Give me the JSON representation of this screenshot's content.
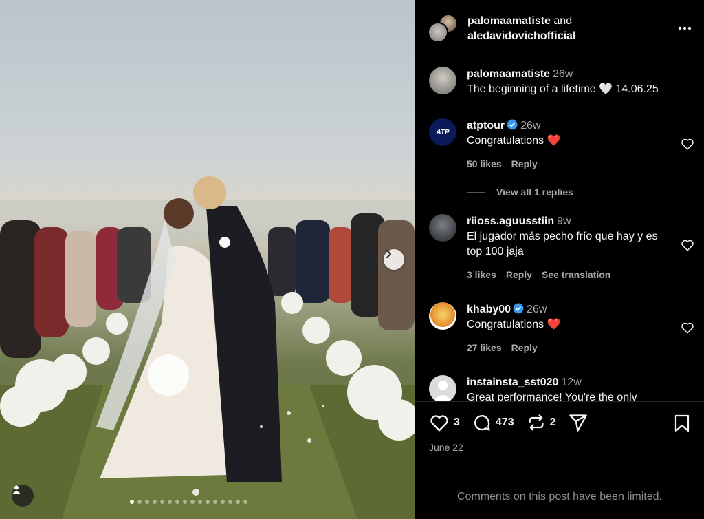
{
  "post": {
    "photo_alt": "Wedding ceremony photo",
    "carousel": {
      "total": 16,
      "active": 0
    }
  },
  "header": {
    "user1": "palomaamatiste",
    "joiner": "and",
    "user2": "aledavidovichofficial"
  },
  "caption": {
    "username": "palomaamatiste",
    "time": "26w",
    "text": "The beginning of a lifetime 🤍 14.06.25"
  },
  "comments": [
    {
      "username": "atptour",
      "verified": true,
      "time": "26w",
      "text": "Congratulations ❤️",
      "likes": "50 likes",
      "reply": "Reply"
    },
    {
      "username": "riioss.aguusstiin",
      "verified": false,
      "time": "9w",
      "text": "El jugador más pecho frío que hay y es top 100 jaja",
      "likes": "3 likes",
      "reply": "Reply",
      "translate": "See translation"
    },
    {
      "username": "khaby00",
      "verified": true,
      "time": "26w",
      "text": "Congratulations ❤️",
      "likes": "27 likes",
      "reply": "Reply"
    },
    {
      "username": "instainsta_sst020",
      "verified": false,
      "time": "12w",
      "text": "Great performance! You're the only"
    }
  ],
  "view_replies": "View all 1 replies",
  "actions": {
    "likes": "3",
    "comments": "473",
    "reposts": "2"
  },
  "date": "June 22",
  "limited_note": "Comments on this post have been limited.",
  "icons": {
    "like": "heart-icon",
    "comment": "comment-bubble-icon",
    "repost": "repost-icon",
    "share": "send-icon",
    "save": "bookmark-icon",
    "more": "more-dots-icon",
    "verified": "verified-badge-icon",
    "next": "chevron-right-icon",
    "tag": "user-tag-icon"
  },
  "colors": {
    "verified": "#3897f0",
    "heart": "#ff3040",
    "muted": "#a8a8a8"
  }
}
